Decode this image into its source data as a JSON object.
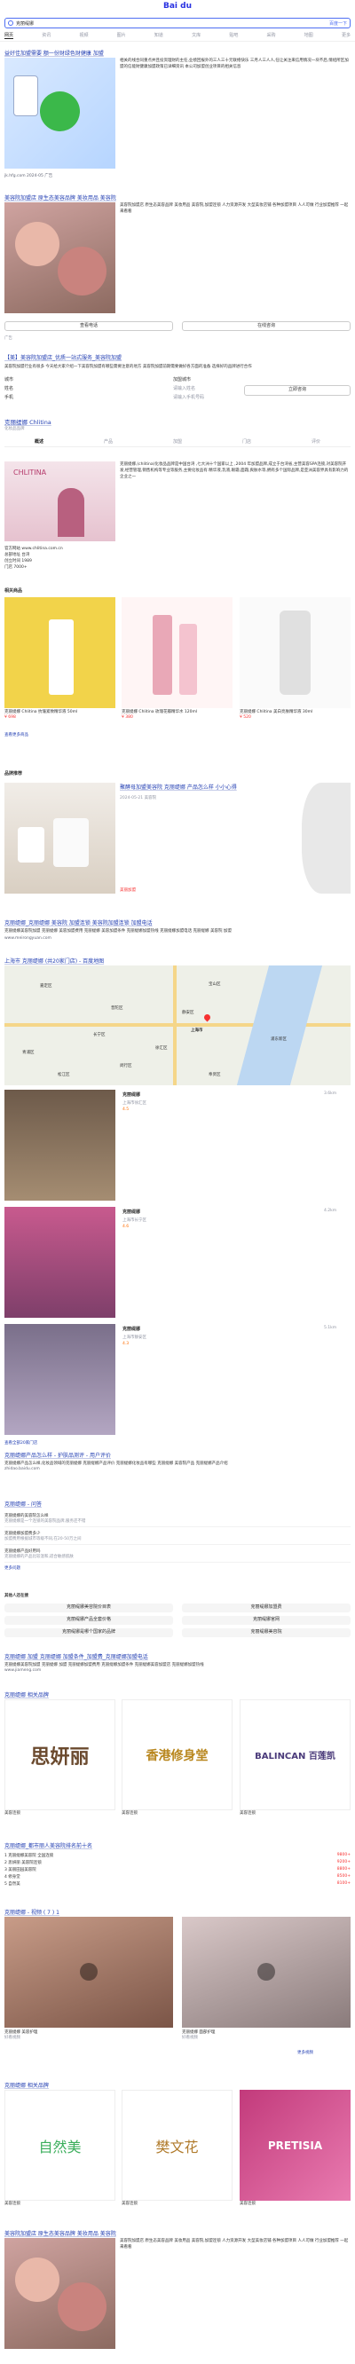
{
  "header": {
    "logo": "Bai du",
    "search_text": "克丽缇娜",
    "search_btn": "百度一下",
    "tabs": [
      "网页",
      "资讯",
      "视频",
      "图片",
      "知道",
      "文库",
      "贴吧",
      "采购",
      "地图",
      "更多"
    ]
  },
  "r1": {
    "title": "益好佳加盟需要 额一份财绿色财健康 加盟",
    "desc": "相关的线合同重点并且投资理财的主任,业绩回报外的三人三十元联络快乐 三月人三人人,任让关注来信用情况一块不后,情绍所区加盟的信能财健康加盟政策已详细资讯 本公司加盟创业项目的相关信息",
    "url": "jk.hfg.com 2024-05 广告",
    "meta": "加盟 信息"
  },
  "r2": {
    "title": "美容院加盟店 原生态美容品牌 美妆用品 美容院",
    "desc": "美容院加盟店 原生态美容品牌 美妆用品 美容院,加盟连锁 人力资源开发 大型美妆店铺 各种加盟项目 人人可做 行业加盟推荐 一起来看看",
    "btn1": "查看电话",
    "btn2": "在线咨询",
    "meta": "广告"
  },
  "r3": {
    "title": "【美】美容院加盟店_优质一站式服务_美容院加盟",
    "desc": "美容院加盟行业有很多 今天给大家介绍一下美容院加盟有哪些需要注意的地方 美容院加盟前期需要做好各方面的准备 选择好的品牌进行合作",
    "field1": "城市",
    "field1_val": "加盟城市",
    "field2": "姓名",
    "field2_val": "请输入姓名",
    "field3": "手机",
    "field3_val": "请输入手机号码",
    "submit": "立即咨询"
  },
  "kg": {
    "title": "克丽缇娜 Chlitina",
    "sub": "化妆品品牌",
    "tabs": [
      "概述",
      "产品",
      "加盟",
      "门店",
      "评价"
    ],
    "desc": "克丽缇娜,(chlitina)化妆品品牌是中国台湾 ,七大洲十个国家以上 ,2004 年加盟品牌,成立于台湾省,主营美容SPA连锁,对美容院开发,经营管理,销售机构等专业等服务,主要化妆品有:精华液,乳液,眼霜,面霜,爽肤水等,拥有多个国际品牌,是亚洲美容界具有影响力的企业之一",
    "info": [
      "官方网站 www.chlitina.com.cn",
      "总部地址 台湾",
      "创立时间 1989",
      "门店 7000+"
    ],
    "products_title": "相关商品",
    "products": [
      {
        "name": "克丽缇娜 Chlitina 抗皱紧致精华液 50ml",
        "price": "¥ 698"
      },
      {
        "name": "克丽缇娜 Chlitina 玫瑰花瓣精华水 120ml",
        "price": "¥ 380"
      },
      {
        "name": "克丽缇娜 Chlitina 美白亮肤精华液 30ml",
        "price": "¥ 520"
      }
    ],
    "more": "查看更多商品"
  },
  "r4": {
    "title": "品牌推荐",
    "item_title": "聚酵母加盟美容院 克丽缇娜 产品怎么样 小小心得",
    "item_desc": "2024-05-21 美容院",
    "author": "美丽加盟"
  },
  "r5": {
    "title": "克丽缇娜_克丽缇娜 美容院 加盟连锁 美容院加盟连锁 加盟电话",
    "desc": "克丽缇娜美容院加盟 克丽缇娜 美容加盟费用 克丽缇娜 美容加盟条件 克丽缇娜加盟热线 克丽缇娜加盟电话 克丽缇娜 美容院 加盟",
    "url": "www.meirongyuan.com"
  },
  "map": {
    "title": "上海市 克丽缇娜 (共20家门店) - 百度地图",
    "places": [
      "嘉定区",
      "宝山区",
      "静安区",
      "普陀区",
      "长宁区",
      "浦东新区",
      "徐汇区",
      "闵行区",
      "青浦区",
      "松江区",
      "奉贤区",
      "上海市"
    ],
    "stores": [
      {
        "name": "克丽缇娜",
        "addr": "上海市徐汇区",
        "dist": "3.6km",
        "rating": "4.5"
      },
      {
        "name": "克丽缇娜",
        "addr": "上海市长宁区",
        "dist": "4.2km",
        "rating": "4.6"
      },
      {
        "name": "克丽缇娜",
        "addr": "上海市静安区",
        "dist": "5.1km",
        "rating": "4.3"
      }
    ],
    "more": "查看全部20家门店"
  },
  "r6": {
    "title": "克丽缇娜产品怎么样 - 护肤品测评 - 用户评价",
    "desc": "克丽缇娜产品怎么样,化妆品领域的克丽缇娜 克丽缇娜产品评价 克丽缇娜化妆品有哪些 克丽缇娜 美容院产品 克丽缇娜产品介绍",
    "url": "zhidao.baidu.com"
  },
  "r7": {
    "title": "克丽缇娜 - 问答",
    "qa": [
      {
        "q": "克丽缇娜的美容院怎么样",
        "a": "克丽缇娜是一个连锁的美容院品牌,服务还不错"
      },
      {
        "q": "克丽缇娜加盟费多少",
        "a": "加盟费用根据城市等级不同,在20-50万之间"
      },
      {
        "q": "克丽缇娜产品好用吗",
        "a": "克丽缇娜的产品比较温和,适合敏感肌肤"
      }
    ],
    "more": "更多问题"
  },
  "rel1": {
    "title": "其他人还在搜",
    "items": [
      "克丽缇娜美容院价目表",
      "克丽缇娜加盟费",
      "克丽缇娜产品全套价格",
      "克丽缇娜官网",
      "克丽缇娜是哪个国家的品牌",
      "克丽缇娜美容院"
    ]
  },
  "r8": {
    "title": "克丽缇娜 加盟 克丽缇娜 加盟条件_加盟费_克丽缇娜加盟电话",
    "desc": "克丽缇娜美容院加盟 克丽缇娜 加盟 克丽缇娜加盟费用 克丽缇娜加盟条件 克丽缇娜美容加盟店 克丽缇娜加盟热线",
    "url": "www.jiameng.com"
  },
  "brands": {
    "title": "克丽缇娜 相关品牌",
    "items": [
      {
        "name": "思妍丽",
        "sub": "美容连锁"
      },
      {
        "name": "香港修身堂",
        "sub": "美容连锁"
      },
      {
        "name": "BALINCAN 百莲凯",
        "sub": "美容连锁"
      }
    ]
  },
  "r9": {
    "title": "克丽缇娜_都市丽人美容院排名前十名",
    "list": [
      {
        "t": "1 克丽缇娜美容院 全国连锁",
        "v": "9800+"
      },
      {
        "t": "2 思妍丽 美容院连锁",
        "v": "9200+"
      },
      {
        "t": "3 美丽田园美容院",
        "v": "8800+"
      },
      {
        "t": "4 修身堂",
        "v": "8500+"
      },
      {
        "t": "5 自然美",
        "v": "8100+"
      }
    ]
  },
  "video": {
    "title": "克丽缇娜 - 视频 ( 7 ) 1",
    "items": [
      {
        "name": "克丽缇娜 美容护理",
        "src": "好看视频"
      },
      {
        "name": "克丽缇娜 面部护理",
        "src": "好看视频"
      }
    ],
    "more": "更多视频"
  },
  "brands2": {
    "title": "克丽缇娜 相关品牌",
    "items": [
      {
        "name": "自然美",
        "sub": "美容连锁"
      },
      {
        "name": "樊文花",
        "sub": "美容连锁"
      },
      {
        "name": "PRETISIA",
        "sub": "美容连锁"
      }
    ]
  },
  "r10": {
    "title": "美容院加盟店 原生态美容品牌 美妆用品 美容院",
    "desc": "美容院加盟店 原生态美容品牌 美妆用品 美容院,加盟连锁 人力资源开发 大型美妆店铺 各种加盟项目 人人可做 行业加盟推荐 一起来看看"
  }
}
